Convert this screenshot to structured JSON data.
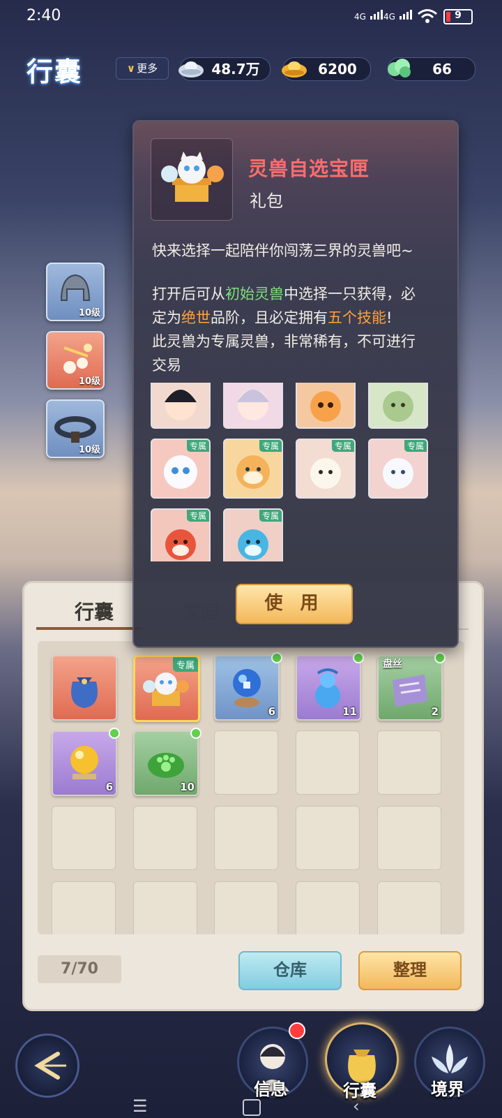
{
  "status_bar": {
    "time": "2:40",
    "net1": "4G",
    "net2": "4G",
    "battery": "9"
  },
  "header": {
    "title": "行囊",
    "more_label": "更多",
    "currencies": [
      {
        "icon": "silver-ingot-icon",
        "value": "48.7万"
      },
      {
        "icon": "gold-ingot-icon",
        "value": "6200"
      },
      {
        "icon": "jade-cloud-icon",
        "value": "66"
      }
    ]
  },
  "side_equipment": [
    {
      "icon": "helmet-icon",
      "level": "10级"
    },
    {
      "icon": "accessory-icon",
      "level": "10级"
    },
    {
      "icon": "belt-icon",
      "level": "10级"
    }
  ],
  "popup": {
    "item_name": "灵兽自选宝匣",
    "item_type": "礼包",
    "desc_line1": "快来选择一起陪伴你闯荡三界的灵兽吧~",
    "desc_p2_a": "打开后可从",
    "desc_p2_b": "初始灵兽",
    "desc_p2_c": "中选择一只获得，必",
    "desc_p3_a": "定为",
    "desc_p3_b": "绝世",
    "desc_p3_c": "品阶，且必定拥有",
    "desc_p3_d": "五个技能",
    "desc_p3_e": "!",
    "desc_p4": "此灵兽为专属灵兽，非常稀有，不可进行",
    "desc_p5": "交易",
    "pet_tag": "专属",
    "use_button": "使 用"
  },
  "bag": {
    "tab_active": "行囊",
    "tab_other": "家园",
    "items": [
      {
        "icon": "cloth-bag-icon",
        "count": ""
      },
      {
        "icon": "pet-box-icon",
        "count": "",
        "tag": "专属"
      },
      {
        "icon": "crystal-ball-icon",
        "count": "6"
      },
      {
        "icon": "gourd-icon",
        "count": "11"
      },
      {
        "icon": "scroll-icon",
        "count": "2",
        "tag": "盘丝"
      },
      {
        "icon": "golden-orb-icon",
        "count": "6"
      },
      {
        "icon": "paw-leaf-icon",
        "count": "10"
      }
    ],
    "capacity": "7/70",
    "warehouse_button": "仓库",
    "sort_button": "整理"
  },
  "nav": {
    "info": "信息",
    "bag": "行囊",
    "realm": "境界"
  },
  "colors": {
    "accent_gold": "#f3b85a",
    "accent_teal": "#82cce0",
    "name_red": "#ff6d6d"
  }
}
